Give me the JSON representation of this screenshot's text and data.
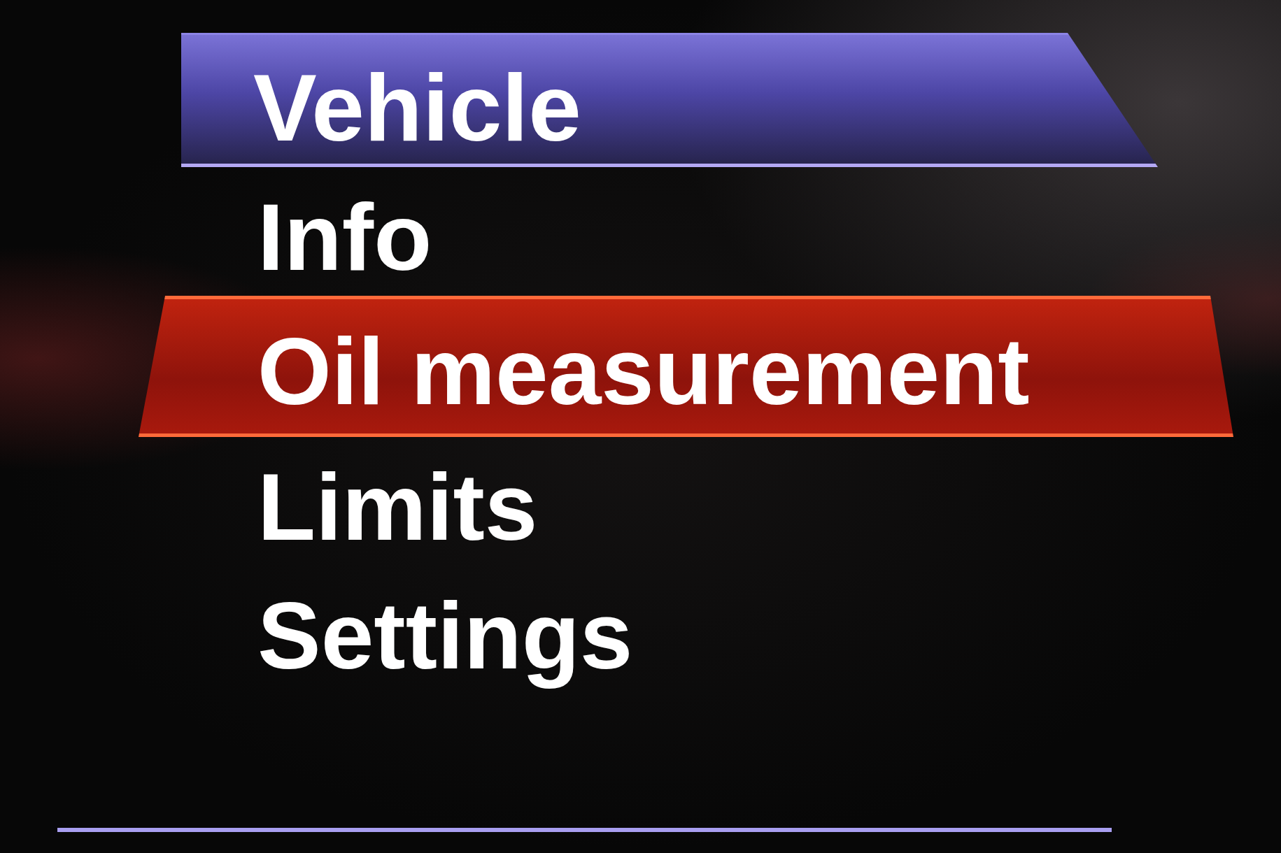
{
  "header": {
    "title": "Vehicle"
  },
  "menu": {
    "items": [
      {
        "label": "Info",
        "selected": false
      },
      {
        "label": "Oil measurement",
        "selected": true
      },
      {
        "label": "Limits",
        "selected": false
      },
      {
        "label": "Settings",
        "selected": false
      }
    ]
  }
}
